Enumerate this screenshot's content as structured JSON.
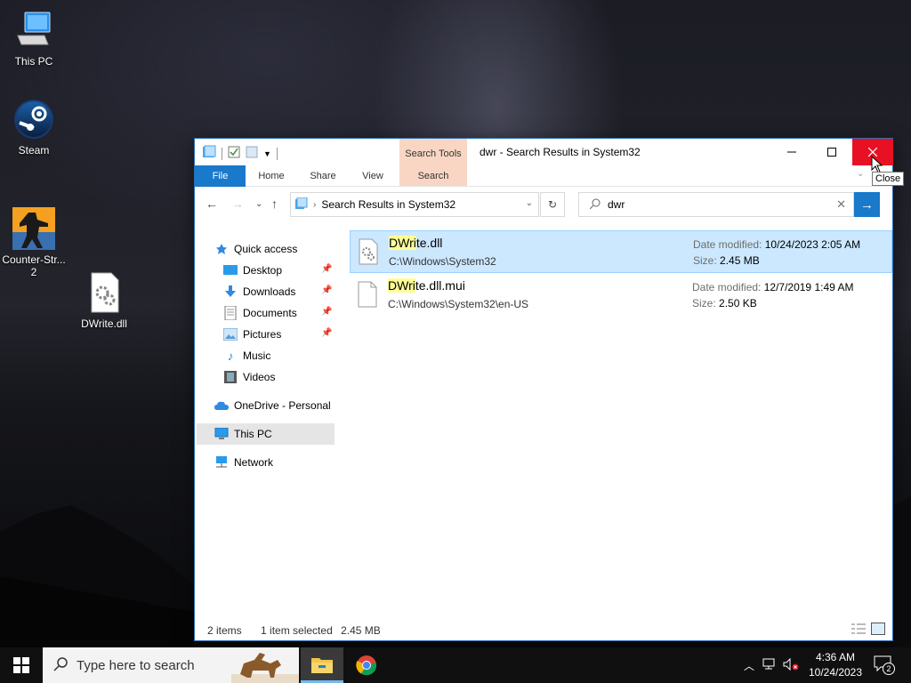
{
  "desktop": {
    "icons": [
      {
        "label": "This PC",
        "icon": "this-pc-icon"
      },
      {
        "label": "Steam",
        "icon": "steam-icon"
      },
      {
        "label": "Counter-Str...\n2",
        "icon": "counter-strike-icon"
      },
      {
        "label": "DWrite.dll",
        "icon": "dll-file-icon"
      }
    ]
  },
  "window": {
    "title": "dwr - Search Results in System32",
    "context_tab": "Search Tools",
    "ribbon_tabs": [
      "File",
      "Home",
      "Share",
      "View",
      "Search"
    ],
    "address": "Search Results in System32",
    "search_value": "dwr",
    "close_tooltip": "Close"
  },
  "nav": {
    "items": [
      {
        "label": "Quick access",
        "icon": "star-icon"
      },
      {
        "label": "Desktop",
        "icon": "desktop-folder-icon",
        "pinned": true
      },
      {
        "label": "Downloads",
        "icon": "downloads-icon",
        "pinned": true
      },
      {
        "label": "Documents",
        "icon": "documents-icon",
        "pinned": true
      },
      {
        "label": "Pictures",
        "icon": "pictures-icon",
        "pinned": true
      },
      {
        "label": "Music",
        "icon": "music-icon"
      },
      {
        "label": "Videos",
        "icon": "videos-icon"
      },
      {
        "label": "OneDrive - Personal",
        "icon": "onedrive-icon"
      },
      {
        "label": "This PC",
        "icon": "this-pc-icon",
        "selected": true
      },
      {
        "label": "Network",
        "icon": "network-icon"
      }
    ]
  },
  "results": [
    {
      "name_highlight": "DWri",
      "name_rest": "te.dll",
      "path": "C:\\Windows\\System32",
      "date_label": "Date modified:",
      "date": "10/24/2023 2:05 AM",
      "size_label": "Size:",
      "size": "2.45 MB",
      "selected": true
    },
    {
      "name_highlight": "DWri",
      "name_rest": "te.dll.mui",
      "path": "C:\\Windows\\System32\\en-US",
      "date_label": "Date modified:",
      "date": "12/7/2019 1:49 AM",
      "size_label": "Size:",
      "size": "2.50 KB",
      "selected": false
    }
  ],
  "status": {
    "count": "2 items",
    "selection": "1 item selected",
    "selection_size": "2.45 MB"
  },
  "taskbar": {
    "search_placeholder": "Type here to search",
    "time": "4:36 AM",
    "date": "10/24/2023",
    "notification_count": "2"
  },
  "colors": {
    "accent": "#1979ca",
    "close_red": "#e81123",
    "selection": "#cce8ff",
    "highlight": "#fdfd96",
    "search_tools": "#f9d6c3"
  }
}
